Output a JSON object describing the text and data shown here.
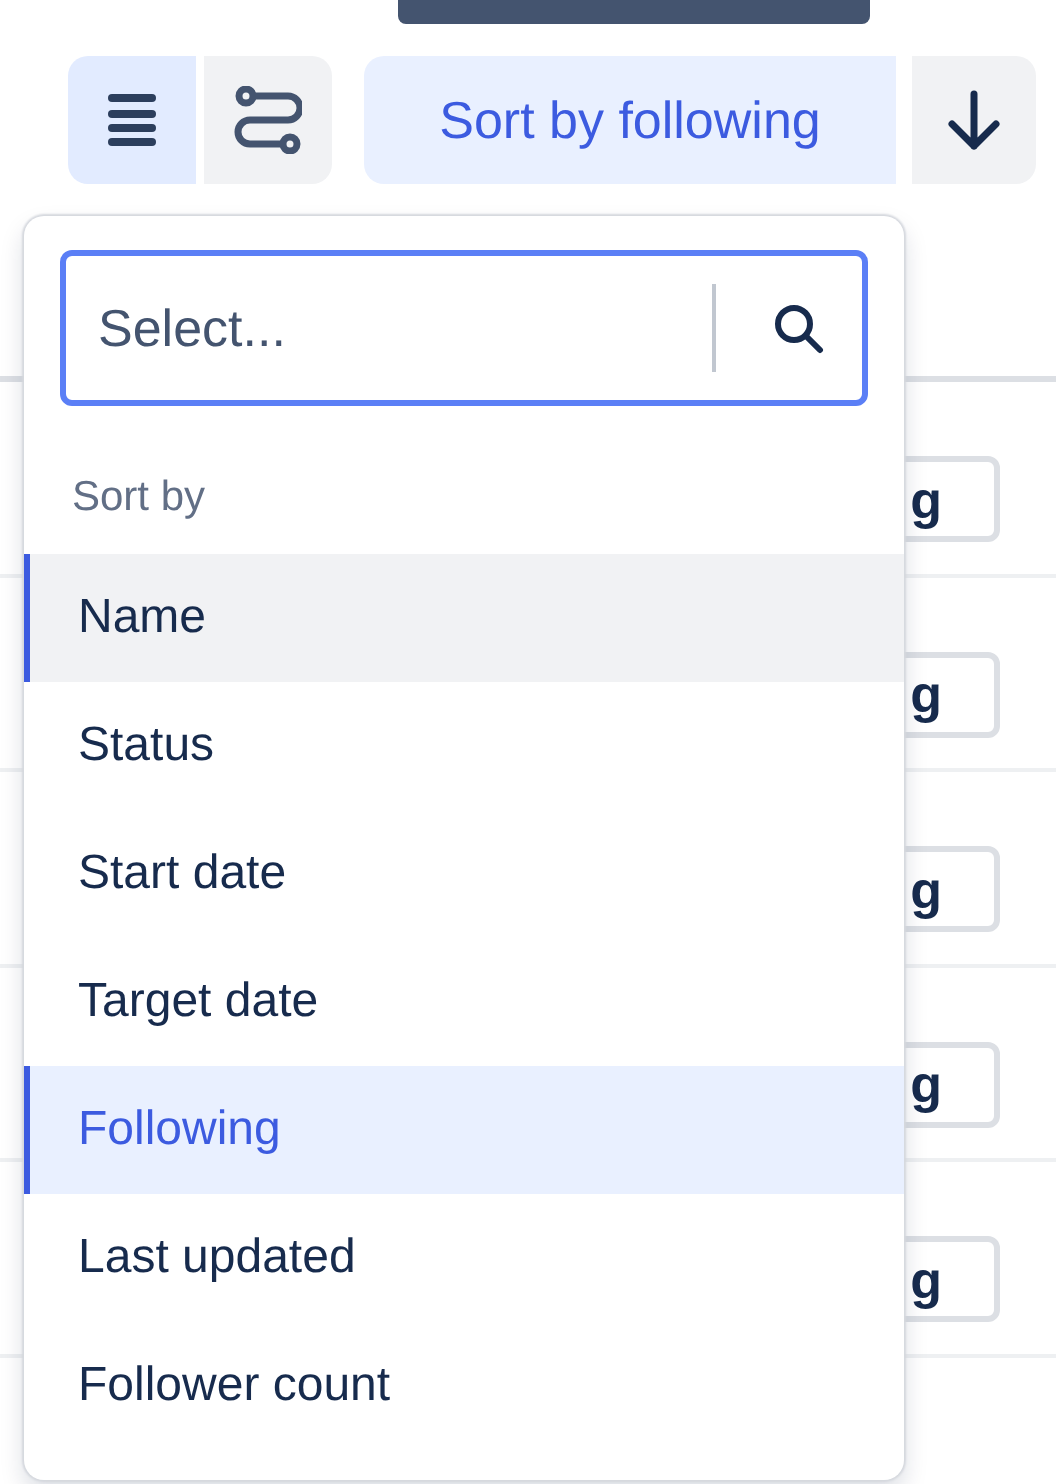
{
  "toolbar": {
    "view_buttons": [
      {
        "kind": "list",
        "selected": true
      },
      {
        "kind": "flow",
        "selected": false
      }
    ],
    "sort_button": "Sort by following",
    "direction_button": {
      "kind": "descending"
    }
  },
  "background_rows": [
    {
      "button": "g"
    },
    {
      "button": "g"
    },
    {
      "button": "g"
    },
    {
      "button": "g"
    },
    {
      "button": "g"
    }
  ],
  "dropdown": {
    "search": {
      "placeholder": "Select..."
    },
    "heading": "Sort by",
    "options": [
      {
        "label": "Name",
        "selected": false,
        "focused": true
      },
      {
        "label": "Status",
        "selected": false,
        "focused": false
      },
      {
        "label": "Start date",
        "selected": false,
        "focused": false
      },
      {
        "label": "Target date",
        "selected": false,
        "focused": false
      },
      {
        "label": "Following",
        "selected": true,
        "focused": false
      },
      {
        "label": "Last updated",
        "selected": false,
        "focused": false
      },
      {
        "label": "Follower count",
        "selected": false,
        "focused": false
      }
    ]
  }
}
